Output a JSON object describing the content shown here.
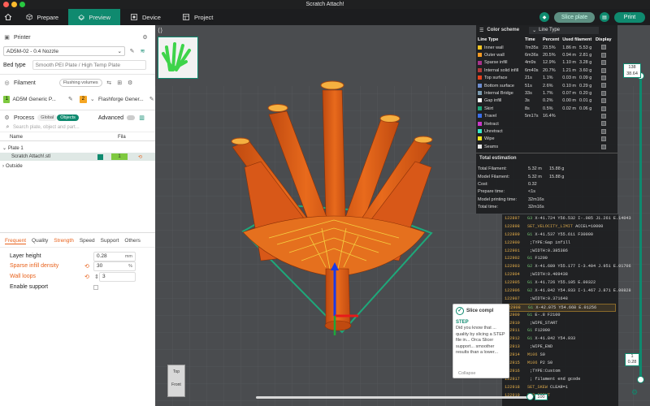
{
  "window": {
    "title": "Scratch Attach!"
  },
  "tabs": [
    {
      "label": "Prepare",
      "active": false
    },
    {
      "label": "Preview",
      "active": true
    },
    {
      "label": "Device",
      "active": false
    },
    {
      "label": "Project",
      "active": false
    }
  ],
  "toolbar": {
    "slice_label": "Slice plate",
    "print_label": "Print"
  },
  "printer": {
    "section_label": "Printer",
    "name": "AD5M-02 - 0.4 Nozzle",
    "bed_type_label": "Bed type",
    "bed_type_value": "Smooth PEI Plate / High Temp Plate"
  },
  "filament": {
    "section_label": "Filament",
    "flushing_label": "Flushing volumes",
    "slots": [
      {
        "num": "1",
        "name": "AD5M Generic P...",
        "color": "#7ec93f"
      },
      {
        "num": "2",
        "name": "Flashforge Gener...",
        "color": "#f5a623"
      }
    ]
  },
  "process": {
    "section_label": "Process",
    "global_label": "Global",
    "objects_label": "Objects",
    "advanced_label": "Advanced",
    "search_placeholder": "Search plate, object and part...",
    "col_name": "Name",
    "col_fila": "Fila",
    "plate": "Plate 1",
    "object": "Scratch Attach!.stl",
    "object_fila": "1",
    "outside": "Outside"
  },
  "settings_tabs": [
    "Frequent",
    "Quality",
    "Strength",
    "Speed",
    "Support",
    "Others"
  ],
  "params": [
    {
      "label": "Layer height",
      "value": "0.28",
      "unit": "mm",
      "modified": false
    },
    {
      "label": "Sparse infill density",
      "value": "30",
      "unit": "%",
      "modified": true
    },
    {
      "label": "Wall loops",
      "value": "3",
      "unit": "",
      "modified": true
    },
    {
      "label": "Enable support",
      "value": "",
      "unit": "",
      "modified": false
    }
  ],
  "color_scheme": {
    "label": "Color scheme",
    "value": "Line Type",
    "headers": [
      "Line Type",
      "Time",
      "Percent",
      "Used filament",
      "Display"
    ],
    "rows": [
      {
        "name": "Inner wall",
        "color": "#f5c623",
        "time": "7m35s",
        "pct": "23.5%",
        "len": "1.86 m",
        "wt": "5.53 g"
      },
      {
        "name": "Outer wall",
        "color": "#f59a23",
        "time": "6m36s",
        "pct": "20.5%",
        "len": "0.94 m",
        "wt": "2.81 g"
      },
      {
        "name": "Sparse infill",
        "color": "#a8328c",
        "time": "4m9s",
        "pct": "12.9%",
        "len": "1.10 m",
        "wt": "3.28 g"
      },
      {
        "name": "Internal solid infill",
        "color": "#b03a3a",
        "time": "6m40s",
        "pct": "20.7%",
        "len": "1.21 m",
        "wt": "3.60 g"
      },
      {
        "name": "Top surface",
        "color": "#e8421c",
        "time": "21s",
        "pct": "1.1%",
        "len": "0.03 m",
        "wt": "0.09 g"
      },
      {
        "name": "Bottom surface",
        "color": "#6c8ccf",
        "time": "51s",
        "pct": "2.6%",
        "len": "0.10 m",
        "wt": "0.29 g"
      },
      {
        "name": "Internal Bridge",
        "color": "#7a9ab0",
        "time": "33s",
        "pct": "1.7%",
        "len": "0.07 m",
        "wt": "0.20 g"
      },
      {
        "name": "Gap infill",
        "color": "#ffffff",
        "time": "3s",
        "pct": "0.2%",
        "len": "0.00 m",
        "wt": "0.01 g"
      },
      {
        "name": "Skirt",
        "color": "#1ea87a",
        "time": "8s",
        "pct": "0.5%",
        "len": "0.02 m",
        "wt": "0.06 g"
      },
      {
        "name": "Travel",
        "color": "#3a6ee8",
        "time": "5m17s",
        "pct": "16.4%",
        "len": "",
        "wt": ""
      },
      {
        "name": "Retract",
        "color": "#c838c8",
        "time": "",
        "pct": "",
        "len": "",
        "wt": ""
      },
      {
        "name": "Unretract",
        "color": "#3ae8c8",
        "time": "",
        "pct": "",
        "len": "",
        "wt": ""
      },
      {
        "name": "Wipe",
        "color": "#f5e623",
        "time": "",
        "pct": "",
        "len": "",
        "wt": ""
      },
      {
        "name": "Seams",
        "color": "#e8e8e8",
        "time": "",
        "pct": "",
        "len": "",
        "wt": ""
      }
    ]
  },
  "estimation": {
    "title": "Total estimation",
    "rows": [
      {
        "label": "Total Filament:",
        "a": "5.32 m",
        "b": "15.88 g"
      },
      {
        "label": "Model Filament:",
        "a": "5.32 m",
        "b": "15.88 g"
      },
      {
        "label": "Cost:",
        "a": "0.32",
        "b": ""
      },
      {
        "label": "Prepare time:",
        "a": "<1s",
        "b": ""
      },
      {
        "label": "Model printing time:",
        "a": "32m16s",
        "b": ""
      },
      {
        "label": "Total time:",
        "a": "32m16s",
        "b": ""
      }
    ]
  },
  "gcode": [
    {
      "ln": "122897",
      "cmd": "G3",
      "rest": "X-41.724 Y56.532 I-.085 J1.261 E.14043"
    },
    {
      "ln": "122898",
      "cmd": "SET_VELOCITY_LIMIT",
      "rest": "ACCEL=10000"
    },
    {
      "ln": "122899",
      "cmd": "G1",
      "rest": "X-41.537 Y55.611 F30000"
    },
    {
      "ln": "122900",
      "cmd": "",
      "rest": ";TYPE:Gap infill"
    },
    {
      "ln": "122901",
      "cmd": "",
      "rest": ";WIDTH:0.385386"
    },
    {
      "ln": "122902",
      "cmd": "G1",
      "rest": "F1200"
    },
    {
      "ln": "122903",
      "cmd": "G2",
      "rest": "X-41.689 Y55.177 I-3.404 J.951 E.01706"
    },
    {
      "ln": "122904",
      "cmd": "",
      "rest": ";WIDTH:0.409438"
    },
    {
      "ln": "122905",
      "cmd": "G1",
      "rest": "X-41.726 Y55.105 E.00322"
    },
    {
      "ln": "122906",
      "cmd": "G2",
      "rest": "X-41.842 Y54.933 I-1.467 J.871 E.00828"
    },
    {
      "ln": "122907",
      "cmd": "",
      "rest": ";WIDTH:0.371648"
    },
    {
      "ln": "122908",
      "cmd": "G1",
      "rest": "X-42.075 Y54.668 E.01256"
    },
    {
      "ln": "122909",
      "cmd": "G1",
      "rest": "E-.8 F2100"
    },
    {
      "ln": "122910",
      "cmd": "",
      "rest": ";WIPE_START"
    },
    {
      "ln": "122911",
      "cmd": "G1",
      "rest": "F12000"
    },
    {
      "ln": "122912",
      "cmd": "G1",
      "rest": "X-41.842 Y54.933"
    },
    {
      "ln": "122913",
      "cmd": "",
      "rest": ";WIPE_END"
    },
    {
      "ln": "122914",
      "cmd": "M106",
      "rest": "S0"
    },
    {
      "ln": "122915",
      "cmd": "M106",
      "rest": "P2 S0"
    },
    {
      "ln": "122916",
      "cmd": "",
      "rest": ";TYPE:Custom"
    },
    {
      "ln": "122917",
      "cmd": "",
      "rest": "; filament end gcode"
    },
    {
      "ln": "122918",
      "cmd": "SET_SKEW",
      "rest": "CLEAR=1"
    },
    {
      "ln": "122919",
      "cmd": "END_PRINT",
      "rest": ""
    }
  ],
  "notification": {
    "title": "Slice compl",
    "subtitle": "STEP",
    "body": "Did you know that ... quality by slicing a STEP file in... Orca Slicer support... smoother results than a lower...",
    "collapse": "Collapse"
  },
  "layer_slider": {
    "top_value": "138",
    "top_height": "38.64",
    "bottom_value": "1",
    "bottom_height": "0.28"
  },
  "move_slider": {
    "value": "100"
  },
  "view_cube": {
    "top": "Top",
    "front": "Front"
  }
}
